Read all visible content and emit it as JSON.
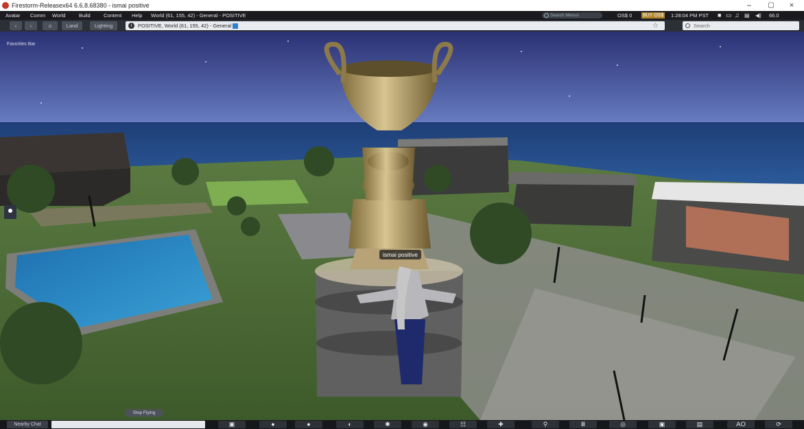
{
  "window": {
    "title": "Firestorm-Releasex64 6.6.8.68380 - ismai positive",
    "controls": {
      "minimize": "–",
      "maximize": "✕",
      "close": "×"
    }
  },
  "menubar": {
    "items": [
      "Avatar",
      "Comm",
      "World",
      "Build",
      "Content",
      "Help"
    ],
    "location": "World (61, 155, 42) - General - POSITIVE",
    "search_placeholder": "Search Menus",
    "balance": "OS$ 0",
    "buy_label": "BUY OS$",
    "time": "1:28:04 PM PST",
    "volume_level": "66.0"
  },
  "navbar": {
    "back": "‹",
    "forward": "›",
    "home": "⌂",
    "land_label": "Land",
    "lighting_label": "Lighting",
    "location_text": "POSITIVE, World (61, 155, 42) - General",
    "search_placeholder": "Search"
  },
  "favorites_bar": "Favorites Bar",
  "avatar_name": "ismai positive",
  "stop_flying": "Stop Flying",
  "bottombar": {
    "nearby_chat": "Nearby Chat",
    "toolbar_buttons": [
      "▣",
      "●",
      "●",
      "◐",
      "✱",
      "◉",
      "☷",
      "✚",
      "⚲",
      "Ⅲ",
      "◎",
      "▣",
      "▤",
      "AO",
      "⟳"
    ]
  },
  "colors": {
    "menubar_bg": "#1a1a1f",
    "navbar_bg": "#2b2f36",
    "buy_accent": "#b0852c"
  }
}
